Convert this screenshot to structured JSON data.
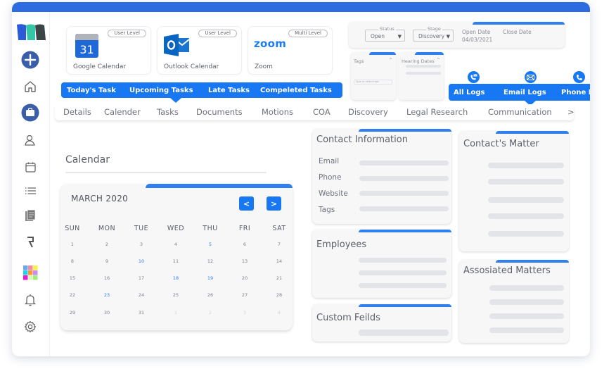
{
  "integrations": [
    {
      "name": "Google Calendar",
      "level": "User Level",
      "icon": "google-calendar-icon",
      "icon_text": "31"
    },
    {
      "name": "Outlook Calendar",
      "level": "User Level",
      "icon": "outlook-icon",
      "icon_text": "O"
    },
    {
      "name": "Zoom",
      "level": "Multi Level",
      "icon": "zoom-icon",
      "icon_text": "zoom"
    }
  ],
  "matter_status": {
    "status_label": "Status",
    "status_value": "Open",
    "stage_label": "Stage",
    "stage_value": "Discovery",
    "open_date_label": "Open Date",
    "open_date_value": "04/03/2021",
    "close_date_label": "Close Date"
  },
  "tags_panel": {
    "title": "Tags",
    "input_placeholder": "type or select tags"
  },
  "hearing_panel": {
    "title": "Hearing Dates"
  },
  "task_tabs": [
    "Today's Task",
    "Upcoming Tasks",
    "Late Tasks",
    "Compeleted Tasks"
  ],
  "log_tabs": [
    {
      "label": "All Logs",
      "icon": "phone-mail-icon"
    },
    {
      "label": "Email Logs",
      "icon": "envelope-icon"
    },
    {
      "label": "Phone Logs",
      "icon": "phone-icon"
    }
  ],
  "main_tabs": [
    "Details",
    "Calender",
    "Tasks",
    "Documents",
    "Motions",
    "COA",
    "Discovery",
    "Legal Research",
    "Communication"
  ],
  "main_tabs_more": ">",
  "calendar": {
    "heading": "Calendar",
    "month": "MARCH 2020",
    "prev": "<",
    "next": ">",
    "weekdays": [
      "SUN",
      "MON",
      "TUE",
      "WED",
      "THU",
      "FRI",
      "SAT"
    ],
    "weeks": [
      [
        {
          "d": "1"
        },
        {
          "d": "2"
        },
        {
          "d": "3"
        },
        {
          "d": "4"
        },
        {
          "d": "5",
          "hl": true
        },
        {
          "d": "6"
        },
        {
          "d": "7"
        }
      ],
      [
        {
          "d": "8"
        },
        {
          "d": "9"
        },
        {
          "d": "10",
          "hl": true
        },
        {
          "d": "11"
        },
        {
          "d": "12"
        },
        {
          "d": "13"
        },
        {
          "d": "14"
        }
      ],
      [
        {
          "d": "15"
        },
        {
          "d": "16"
        },
        {
          "d": "17"
        },
        {
          "d": "18",
          "hl": true
        },
        {
          "d": "19",
          "hl": true
        },
        {
          "d": "20"
        },
        {
          "d": "21"
        }
      ],
      [
        {
          "d": "22"
        },
        {
          "d": "23",
          "hl": true
        },
        {
          "d": "24"
        },
        {
          "d": "25"
        },
        {
          "d": "26"
        },
        {
          "d": "27"
        },
        {
          "d": "28"
        }
      ],
      [
        {
          "d": "29"
        },
        {
          "d": "30"
        },
        {
          "d": "31"
        },
        {
          "d": "1",
          "dim": true
        },
        {
          "d": "2",
          "dim": true
        },
        {
          "d": "3",
          "dim": true
        },
        {
          "d": "4",
          "dim": true
        }
      ]
    ]
  },
  "contact_info": {
    "title": "Contact Information",
    "fields": [
      "Email",
      "Phone",
      "Website",
      "Tags"
    ]
  },
  "employees": {
    "title": "Employees"
  },
  "custom_fields": {
    "title": "Custom Feilds"
  },
  "contacts_matter": {
    "title": "Contact's Matter"
  },
  "associated_matters": {
    "title": "Assosiated Matters"
  },
  "sidebar": {
    "items": [
      "add",
      "home",
      "matters",
      "contacts",
      "calendar",
      "list",
      "documents",
      "billing",
      "apps",
      "notifications",
      "settings"
    ],
    "active": "matters"
  },
  "colors": {
    "accent": "#1877f2",
    "topbar": "#2c6ce0",
    "active_nav": "#3b5ea8"
  }
}
